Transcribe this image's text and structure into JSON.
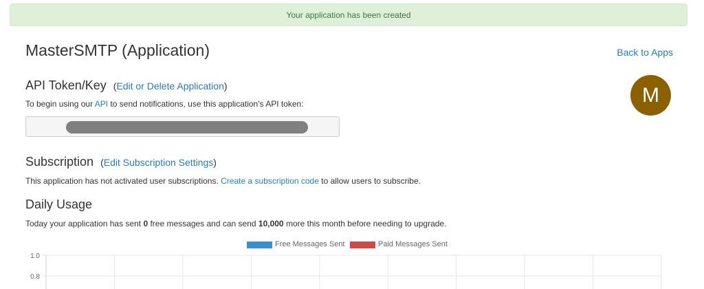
{
  "alert": {
    "message": "Your application has been created"
  },
  "header": {
    "title": "MasterSMTP (Application)",
    "back_link": "Back to Apps"
  },
  "avatar": {
    "letter": "M",
    "color": "#8b6000"
  },
  "api_token": {
    "heading": "API Token/Key",
    "paren_open": "(",
    "edit_link": "Edit or Delete Application",
    "paren_close": ")",
    "desc_before": "To begin using our ",
    "api_link": "API",
    "desc_after": " to send notifications, use this application's API token:"
  },
  "subscription": {
    "heading": "Subscription",
    "paren_open": "(",
    "edit_link": "Edit Subscription Settings",
    "paren_close": ")",
    "desc_before": "This application has not activated user subscriptions. ",
    "create_link": "Create a subscription code",
    "desc_after": " to allow users to subscribe."
  },
  "daily_usage": {
    "heading": "Daily Usage",
    "desc_1": "Today your application has sent ",
    "free_sent": "0",
    "desc_2": " free messages and can send ",
    "remaining": "10,000",
    "desc_3": " more this month before needing to upgrade."
  },
  "chart_data": {
    "type": "bar",
    "series": [
      {
        "name": "Free Messages Sent",
        "color": "#3a8fd1",
        "values": []
      },
      {
        "name": "Paid Messages Sent",
        "color": "#cc4a4a",
        "values": []
      }
    ],
    "y_ticks": [
      "1.0",
      "0.8"
    ],
    "ylim": [
      0,
      1.0
    ],
    "legend_position": "top-center",
    "grid": true
  }
}
